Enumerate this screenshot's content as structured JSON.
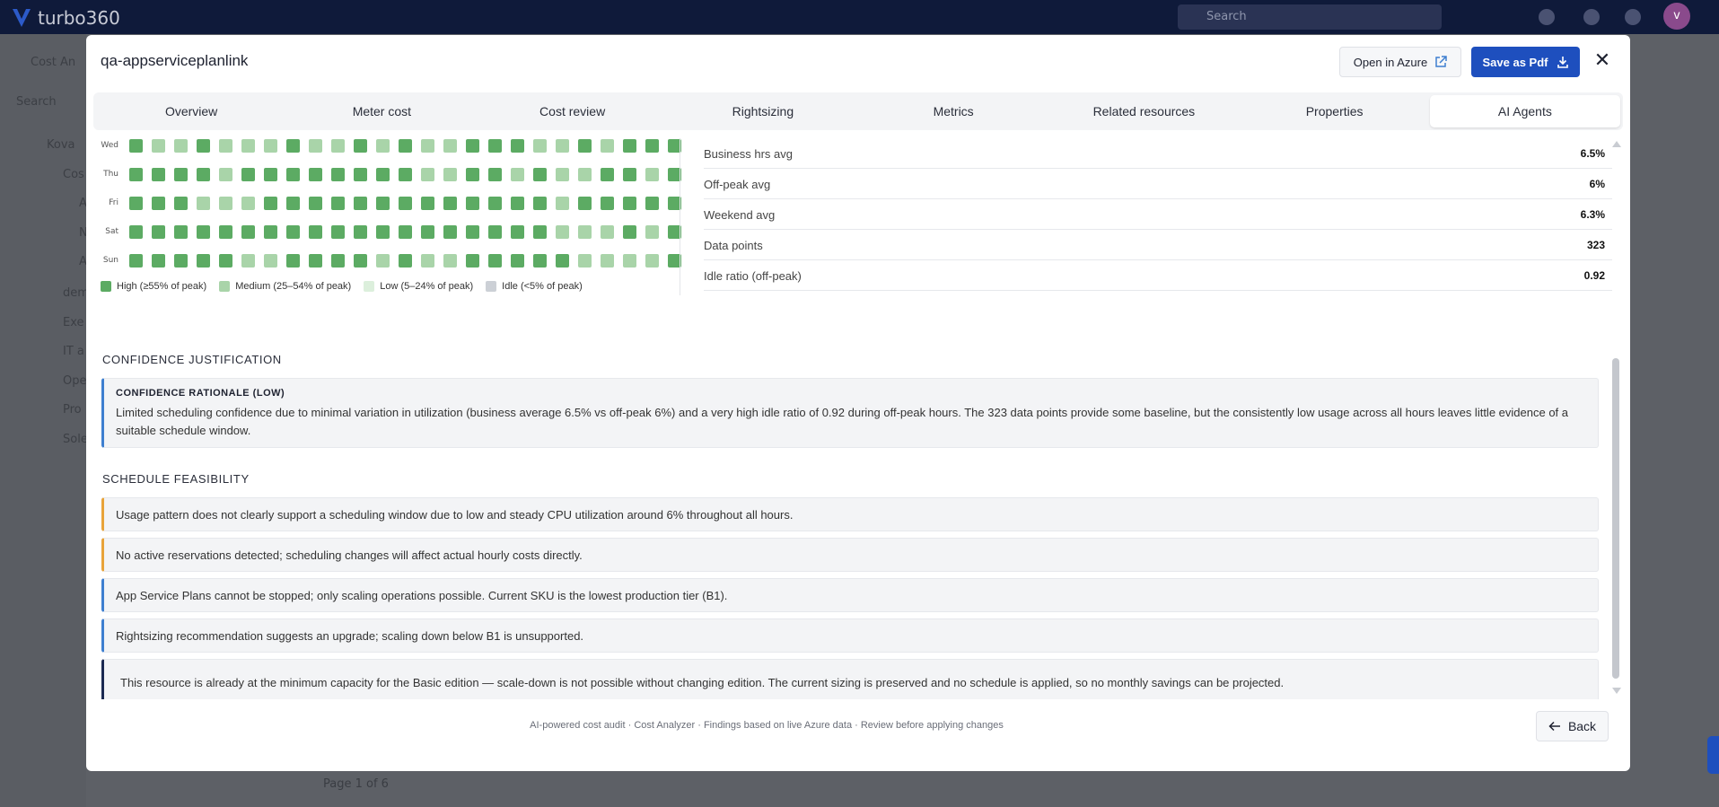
{
  "app": {
    "brand": "turbo360",
    "search_placeholder": "Search",
    "avatar_initial": "v",
    "bg_sidebar": [
      "Cost An",
      "Search",
      "Kova",
      "Cos",
      "A",
      "N",
      "A",
      "dem",
      "Exe",
      "IT a",
      "Ope",
      "Pro",
      "Sole"
    ],
    "bg_pagination": "Page   1   of 6"
  },
  "modal": {
    "title": "qa-appserviceplanlink",
    "open_azure_label": "Open in Azure",
    "save_pdf_label": "Save as Pdf",
    "close_label": "✕",
    "tabs": [
      {
        "label": "Overview",
        "active": false
      },
      {
        "label": "Meter cost",
        "active": false
      },
      {
        "label": "Cost review",
        "active": false
      },
      {
        "label": "Rightsizing",
        "active": false
      },
      {
        "label": "Metrics",
        "active": false
      },
      {
        "label": "Related resources",
        "active": false
      },
      {
        "label": "Properties",
        "active": false
      },
      {
        "label": "AI Agents",
        "active": true
      }
    ]
  },
  "heatmap": {
    "colors": {
      "high": "#5cab63",
      "medium": "#a9d4a9",
      "low": "#dcefdc",
      "idle": "#ccd0d6"
    },
    "rows": [
      {
        "day": "Wed",
        "levels": "HMMHMMMHMMHMHMMHHHMMHMHHH"
      },
      {
        "day": "Thu",
        "levels": "HHHHMHHHHHHHHMMHHMHMMHHMH"
      },
      {
        "day": "Fri",
        "levels": "HHHMMMHHHHHHHHHHHHHMHHHHH"
      },
      {
        "day": "Sat",
        "levels": "HHHHHHHHHHHHHHHHHHHMMMHMH"
      },
      {
        "day": "Sun",
        "levels": "HHHHHMMHHHHMHMMHHHHHMMMMH"
      }
    ],
    "legend": [
      {
        "key": "high",
        "label": "High (≥55% of peak)"
      },
      {
        "key": "medium",
        "label": "Medium (25–54% of peak)"
      },
      {
        "key": "low",
        "label": "Low (5–24% of peak)"
      },
      {
        "key": "idle",
        "label": "Idle (<5% of peak)"
      }
    ]
  },
  "stats": [
    {
      "label": "Business hrs avg",
      "value": "6.5%"
    },
    {
      "label": "Off-peak avg",
      "value": "6%"
    },
    {
      "label": "Weekend avg",
      "value": "6.3%"
    },
    {
      "label": "Data points",
      "value": "323"
    },
    {
      "label": "Idle ratio (off-peak)",
      "value": "0.92"
    }
  ],
  "confidence": {
    "heading": "CONFIDENCE JUSTIFICATION",
    "title": "CONFIDENCE RATIONALE (LOW)",
    "text": "Limited scheduling confidence due to minimal variation in utilization (business average 6.5% vs off-peak 6%) and a very high idle ratio of 0.92 during off-peak hours. The 323 data points provide some baseline, but the consistently low usage across all hours leaves little evidence of a suitable schedule window."
  },
  "feasibility": {
    "heading": "SCHEDULE FEASIBILITY",
    "items": [
      {
        "type": "warn",
        "text": "Usage pattern does not clearly support a scheduling window due to low and steady CPU utilization around 6% throughout all hours."
      },
      {
        "type": "warn",
        "text": "No active reservations detected; scheduling changes will affect actual hourly costs directly."
      },
      {
        "type": "info",
        "text": "App Service Plans cannot be stopped; only scaling operations possible. Current SKU is the lowest production tier (B1)."
      },
      {
        "type": "info",
        "text": "Rightsizing recommendation suggests an upgrade; scaling down below B1 is unsupported."
      },
      {
        "type": "dark",
        "text": "This resource is already at the minimum capacity for the Basic edition — scale-down is not possible without changing edition. The current sizing is preserved and no schedule is applied, so no monthly savings can be projected."
      }
    ]
  },
  "footer": {
    "note": "AI-powered cost audit · Cost Analyzer · Findings based on live Azure data · Review before applying changes",
    "back_label": "Back"
  }
}
